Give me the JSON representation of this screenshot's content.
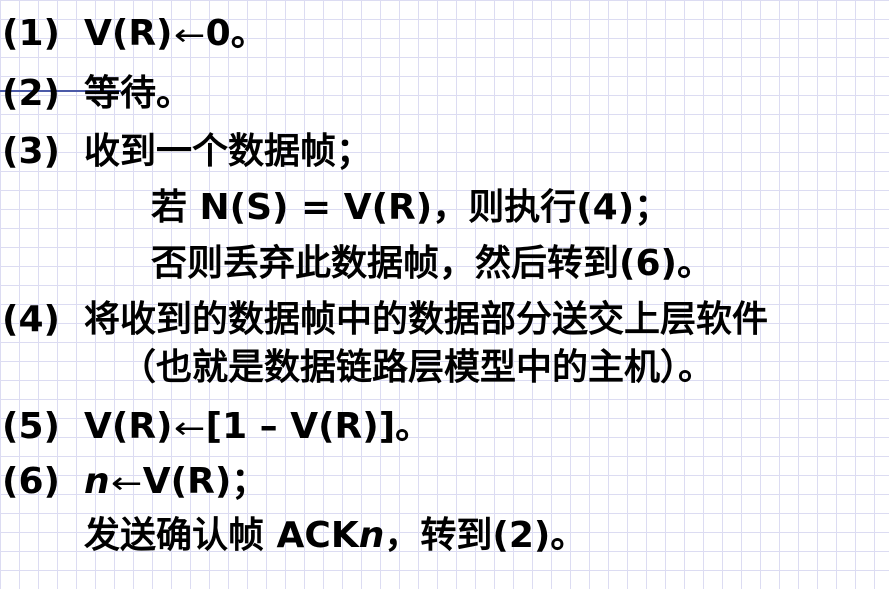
{
  "steps": {
    "s1": {
      "num": "(1)",
      "text_a": "V(R)",
      "arrow": "←",
      "text_b": "0。"
    },
    "s2": {
      "num": "(2)",
      "text": "等待。"
    },
    "s3": {
      "num": "(3)",
      "text": "收到一个数据帧；"
    },
    "s3_cond": "若 N(S) = V(R)，则执行(4)；",
    "s3_else": "否则丢弃此数据帧，然后转到(6)。",
    "s4": {
      "num": "(4)",
      "text": "将收到的数据帧中的数据部分送交上层软件"
    },
    "s4_note": "（也就是数据链路层模型中的主机）。",
    "s5": {
      "num": "(5)",
      "text_a": "V(R)",
      "arrow": "←",
      "text_b": "[1 – V(R)]。"
    },
    "s6": {
      "num": "(6)",
      "var": "n",
      "arrow": "←",
      "text_b": "V(R)；"
    },
    "s6_send": {
      "text_a": "发送确认帧 ACK",
      "var": "n",
      "text_b": "，转到(2)。"
    }
  }
}
